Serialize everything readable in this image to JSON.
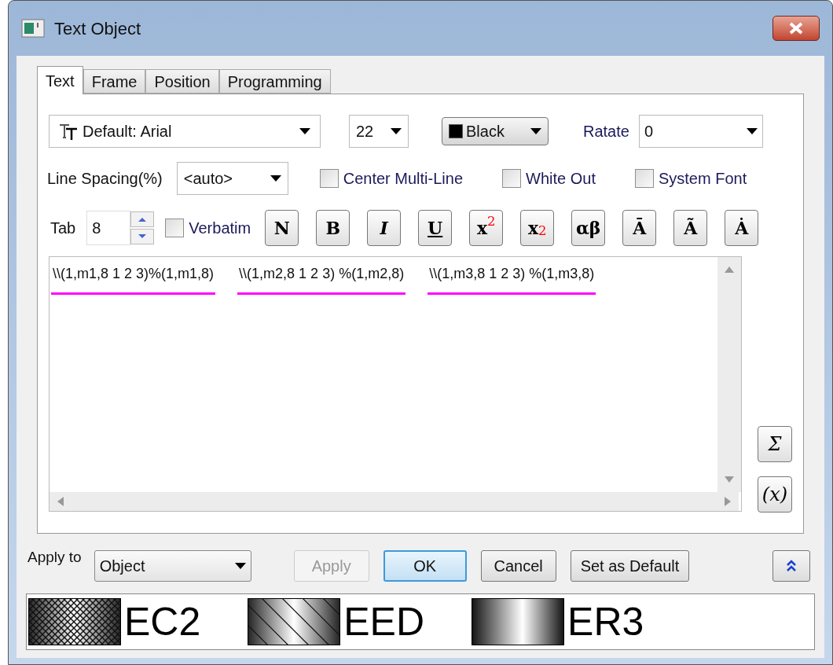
{
  "window": {
    "title": "Text Object"
  },
  "tabs": [
    {
      "label": "Text",
      "selected": true
    },
    {
      "label": "Frame",
      "selected": false
    },
    {
      "label": "Position",
      "selected": false
    },
    {
      "label": "Programming",
      "selected": false
    }
  ],
  "font": {
    "value": "Default: Arial"
  },
  "size": {
    "value": "22"
  },
  "color": {
    "label": "Black",
    "color": "#000000"
  },
  "rotate": {
    "label": "Ratate",
    "value": "0"
  },
  "line_spacing": {
    "label": "Line Spacing(%)",
    "value": "<auto>"
  },
  "options": [
    {
      "label": "Center Multi-Line",
      "checked": false
    },
    {
      "label": "White Out",
      "checked": false
    },
    {
      "label": "System Font",
      "checked": false
    }
  ],
  "tab": {
    "label": "Tab",
    "value": "8"
  },
  "verbatim": {
    "label": "Verbatim",
    "checked": false
  },
  "format_buttons": [
    {
      "label": "N",
      "kind": "normal"
    },
    {
      "label": "B",
      "kind": "bold"
    },
    {
      "label": "I",
      "kind": "italic"
    },
    {
      "label": "U",
      "kind": "underline"
    },
    {
      "label": "x$^{2}$",
      "kind": "superscript"
    },
    {
      "label": "x$_{2}$",
      "kind": "subscript"
    },
    {
      "label": "αβ",
      "kind": "greek"
    },
    {
      "label": "Ā",
      "kind": "overbar"
    },
    {
      "label": "Ã",
      "kind": "tilde"
    },
    {
      "label": "Ȧ",
      "kind": "dot"
    }
  ],
  "editor": {
    "segments": [
      "\\\\(1,m1,8 1 2 3)%(1,m1,8)",
      "\\\\(1,m2,8 1 2 3) %(1,m2,8)",
      "\\\\(1,m3,8 1 2 3) %(1,m3,8)"
    ]
  },
  "side_buttons": [
    "Σ",
    "(x)"
  ],
  "apply_to": {
    "label": "Apply to",
    "value": "Object"
  },
  "buttons": [
    {
      "label": "Apply",
      "disabled": true,
      "default": false
    },
    {
      "label": "OK",
      "disabled": false,
      "default": true
    },
    {
      "label": "Cancel",
      "disabled": false,
      "default": false
    },
    {
      "label": "Set as Default",
      "disabled": false,
      "default": false
    }
  ],
  "preview": [
    {
      "kind": "crosshatch",
      "label": "EC2"
    },
    {
      "kind": "diagonal",
      "label": "EED"
    },
    {
      "kind": "gradient",
      "label": "ER3"
    }
  ]
}
